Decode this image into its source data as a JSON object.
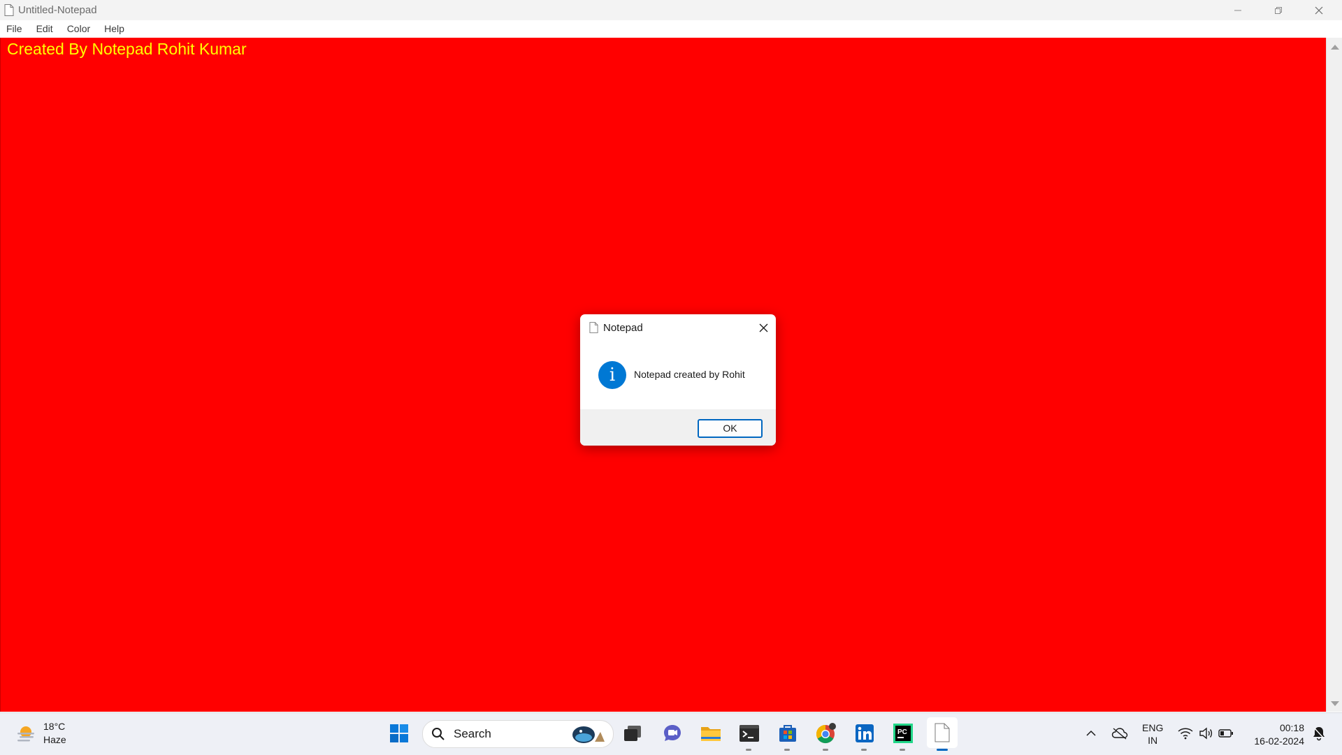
{
  "window": {
    "title": "Untitled-Notepad",
    "menu": [
      "File",
      "Edit",
      "Color",
      "Help"
    ]
  },
  "editor": {
    "text": "Created By Notepad Rohit Kumar",
    "background_color": "#ff0000",
    "text_color": "#ffff00"
  },
  "dialog": {
    "title": "Notepad",
    "message": "Notepad created by Rohit",
    "ok_label": "OK",
    "icon": "info-icon"
  },
  "taskbar": {
    "weather_temp": "18°C",
    "weather_desc": "Haze",
    "search_label": "Search",
    "lang_line1": "ENG",
    "lang_line2": "IN",
    "time": "00:18",
    "date": "16-02-2024",
    "apps": [
      "start-icon",
      "search",
      "task-view-icon",
      "teams-chat-icon",
      "file-explorer-icon",
      "terminal-icon",
      "microsoft-store-icon",
      "chrome-icon",
      "linkedin-icon",
      "pycharm-icon",
      "notepad-icon"
    ]
  }
}
